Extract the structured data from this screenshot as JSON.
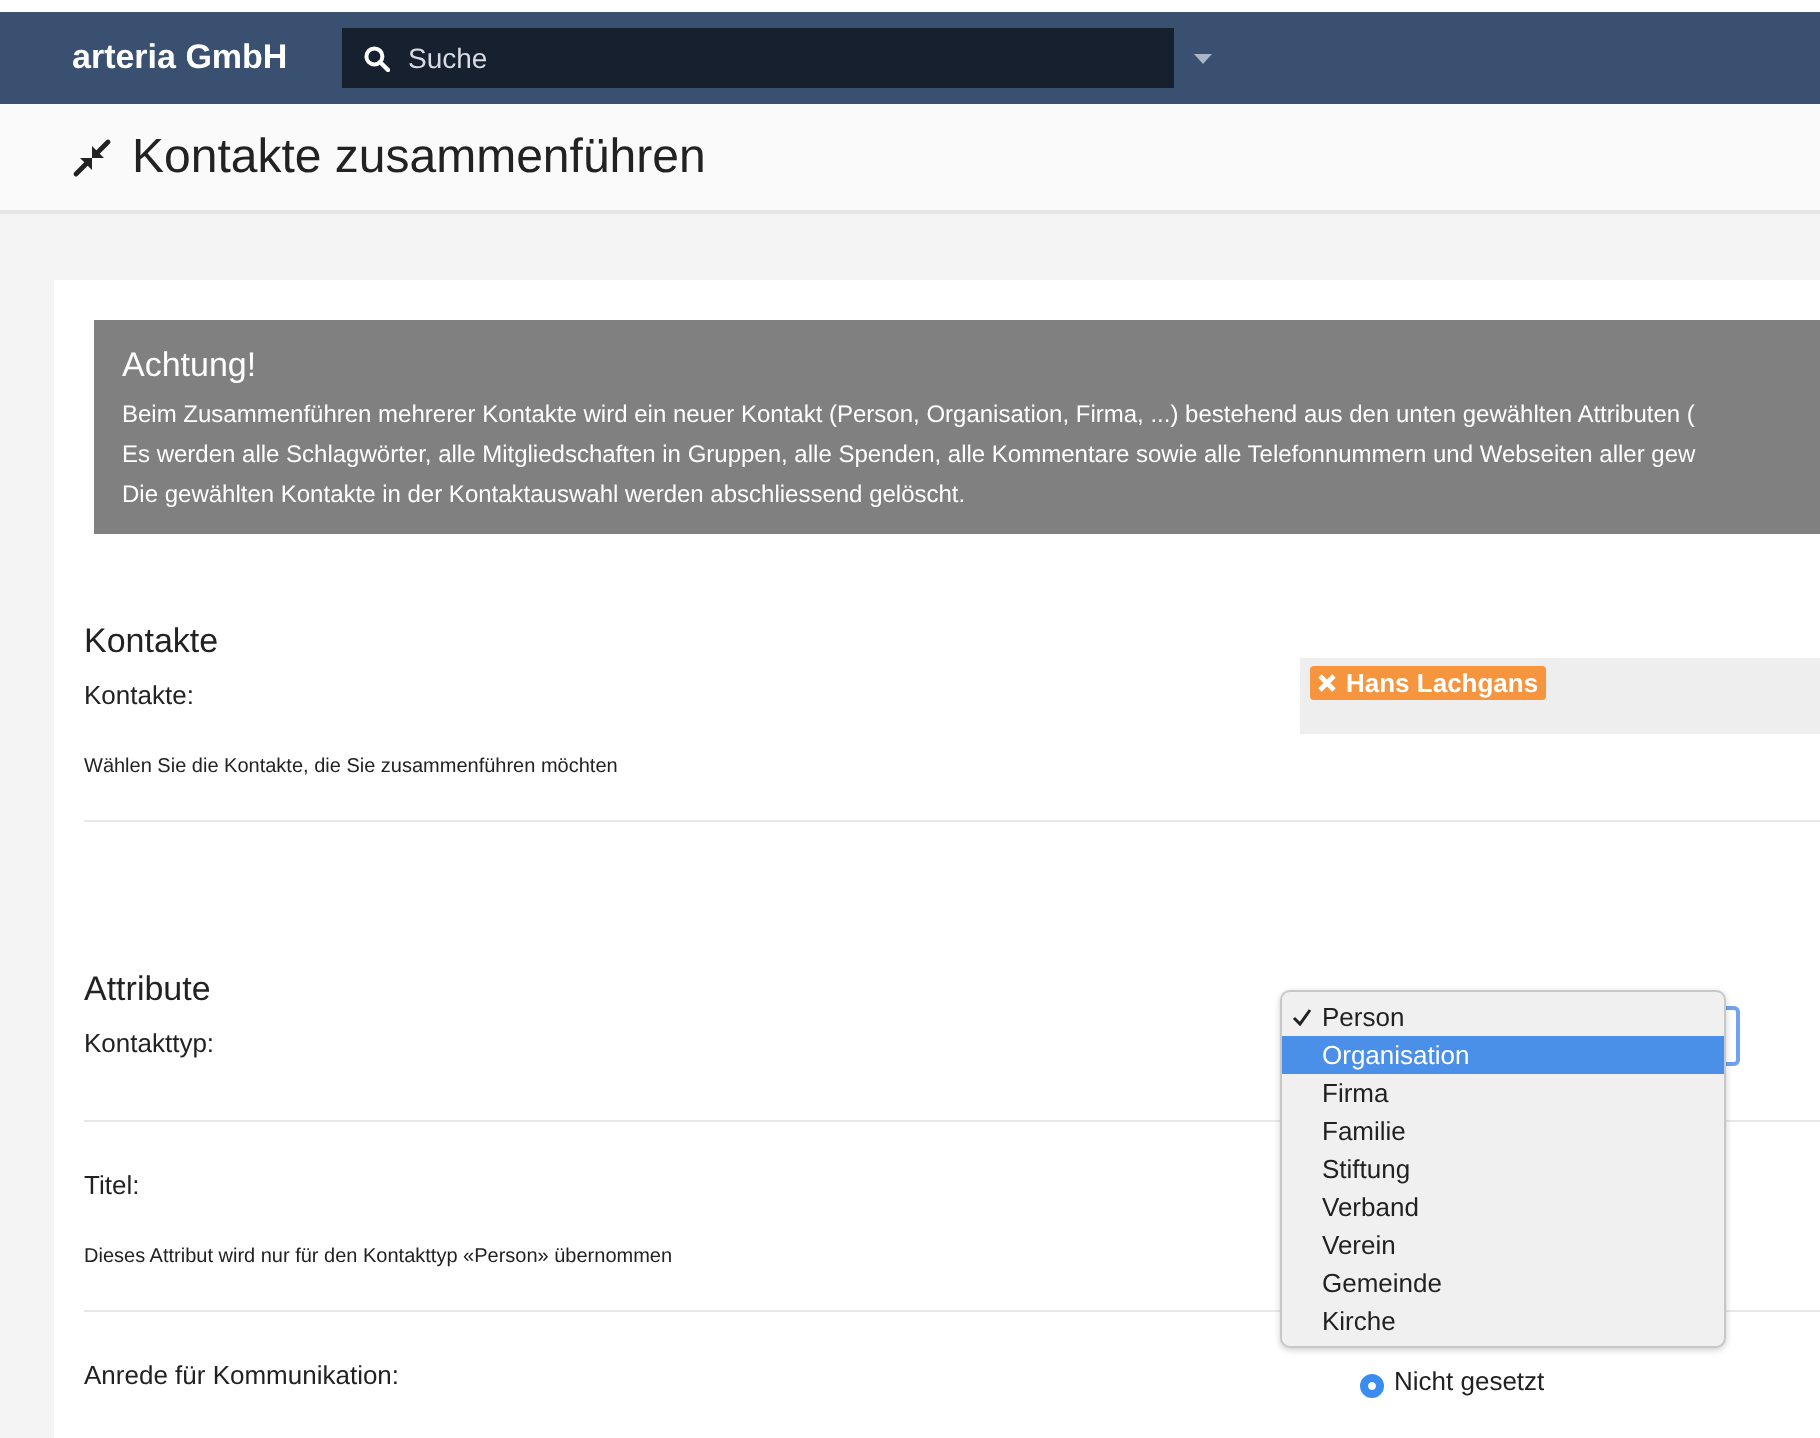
{
  "header": {
    "brand": "arteria GmbH",
    "search": {
      "placeholder": "Suche"
    }
  },
  "page": {
    "title": "Kontakte zusammenführen"
  },
  "alert": {
    "title": "Achtung!",
    "lines": [
      "Beim Zusammenführen mehrerer Kontakte wird ein neuer Kontakt (Person, Organisation, Firma, ...) bestehend aus den unten gewählten Attributen (",
      "Es werden alle Schlagwörter, alle Mitgliedschaften in Gruppen, alle Spenden, alle Kommentare sowie alle Telefonnummern und Webseiten aller gew",
      "Die gewählten Kontakte in der Kontaktauswahl werden abschliessend gelöscht."
    ]
  },
  "sections": [
    {
      "heading": "Kontakte",
      "fields": [
        {
          "kind": "tags",
          "label": "Kontakte:",
          "help": "Wählen Sie die Kontakte, die Sie zusammenführen möchten",
          "tags": [
            "Hans Lachgans"
          ]
        }
      ]
    },
    {
      "heading": "Attribute",
      "fields": [
        {
          "kind": "select",
          "label": "Kontakttyp:",
          "options": [
            {
              "label": "Person",
              "checked": true,
              "selected": false
            },
            {
              "label": "Organisation",
              "checked": false,
              "selected": true
            },
            {
              "label": "Firma",
              "checked": false,
              "selected": false
            },
            {
              "label": "Familie",
              "checked": false,
              "selected": false
            },
            {
              "label": "Stiftung",
              "checked": false,
              "selected": false
            },
            {
              "label": "Verband",
              "checked": false,
              "selected": false
            },
            {
              "label": "Verein",
              "checked": false,
              "selected": false
            },
            {
              "label": "Gemeinde",
              "checked": false,
              "selected": false
            },
            {
              "label": "Kirche",
              "checked": false,
              "selected": false
            }
          ]
        },
        {
          "kind": "empty",
          "label": "Titel:",
          "help": "Dieses Attribut wird nur für den Kontakttyp «Person» übernommen"
        },
        {
          "kind": "radio",
          "label": "Anrede für Kommunikation:",
          "radios": [
            {
              "label": "Nicht gesetzt",
              "selected": true
            }
          ]
        }
      ]
    }
  ]
}
